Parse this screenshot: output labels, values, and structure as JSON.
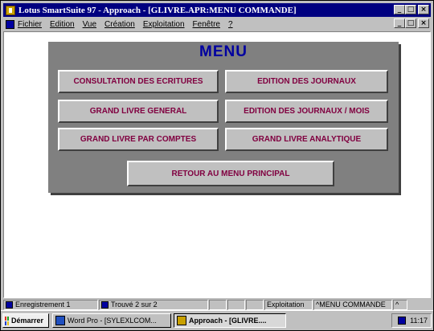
{
  "window": {
    "title": "Lotus SmartSuite 97   - Approach - [GLIVRE.APR:MENU COMMANDE]",
    "minimize": "_",
    "restore": "□",
    "close": "×"
  },
  "menubar": {
    "items": [
      "Fichier",
      "Edition",
      "Vue",
      "Création",
      "Exploitation",
      "Fenêtre",
      "?"
    ]
  },
  "menu_panel": {
    "title": "MENU",
    "buttons": {
      "consultation": "CONSULTATION DES ECRITURES",
      "edition_journaux": "EDITION DES JOURNAUX",
      "grand_livre_general": "GRAND LIVRE GENERAL",
      "edition_journaux_mois": "EDITION DES JOURNAUX / MOIS",
      "grand_livre_comptes": "GRAND LIVRE PAR COMPTES",
      "grand_livre_analytique": "GRAND LIVRE ANALYTIQUE",
      "retour": "RETOUR AU MENU PRINCIPAL"
    },
    "colors": {
      "panel": "#808080",
      "title": "#0000a0",
      "button_text": "#800040"
    }
  },
  "statusbar": {
    "record": "Enregistrement 1",
    "found": "Trouvé 2 sur 2",
    "mode": "Exploitation",
    "view": "^MENU COMMANDE",
    "caret": "^"
  },
  "taskbar": {
    "start": "Démarrer",
    "tasks": [
      "Word Pro - [SYLEXLCOM...",
      "Approach - [GLIVRE...."
    ],
    "clock": "11:17"
  }
}
